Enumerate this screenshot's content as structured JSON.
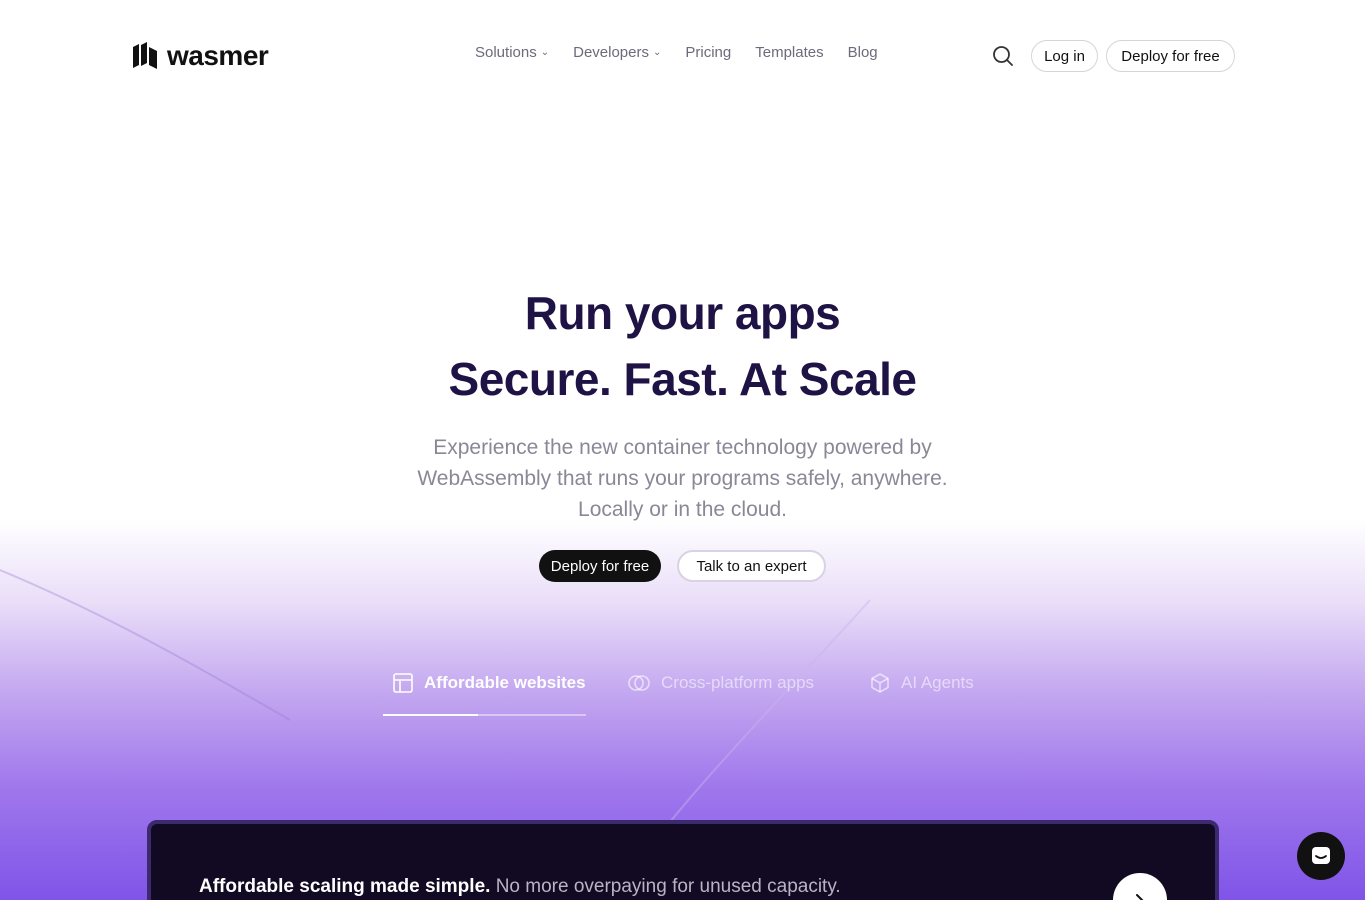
{
  "brand": {
    "name": "wasmer"
  },
  "nav": {
    "items": [
      {
        "label": "Solutions",
        "has_dropdown": true
      },
      {
        "label": "Developers",
        "has_dropdown": true
      },
      {
        "label": "Pricing",
        "has_dropdown": false
      },
      {
        "label": "Templates",
        "has_dropdown": false
      },
      {
        "label": "Blog",
        "has_dropdown": false
      }
    ],
    "search_icon": "search-icon",
    "login_label": "Log in",
    "deploy_label": "Deploy for free"
  },
  "hero": {
    "title_line1": "Run your apps",
    "title_line2": "Secure. Fast. At Scale",
    "subtitle_line1": "Experience the new container technology powered by",
    "subtitle_line2": "WebAssembly that runs your programs safely, anywhere.",
    "subtitle_line3": "Locally or in the cloud.",
    "cta_primary": "Deploy for free",
    "cta_secondary": "Talk to an expert"
  },
  "tabs": {
    "items": [
      {
        "label": "Affordable websites",
        "icon": "layout-icon",
        "active": true
      },
      {
        "label": "Cross-platform apps",
        "icon": "overlap-circles-icon",
        "active": false
      },
      {
        "label": "AI Agents",
        "icon": "cube-icon",
        "active": false
      }
    ],
    "active_progress": 0.47
  },
  "card": {
    "headline": "Affordable scaling made simple.",
    "body": "No more overpaying for unused capacity.",
    "next_icon": "chevron-right-icon"
  },
  "chat": {
    "icon": "chat-icon"
  },
  "colors": {
    "heading": "#1f1245",
    "accent_purple": "#8054e8",
    "dark": "#111111",
    "card_bg": "#120a22"
  }
}
